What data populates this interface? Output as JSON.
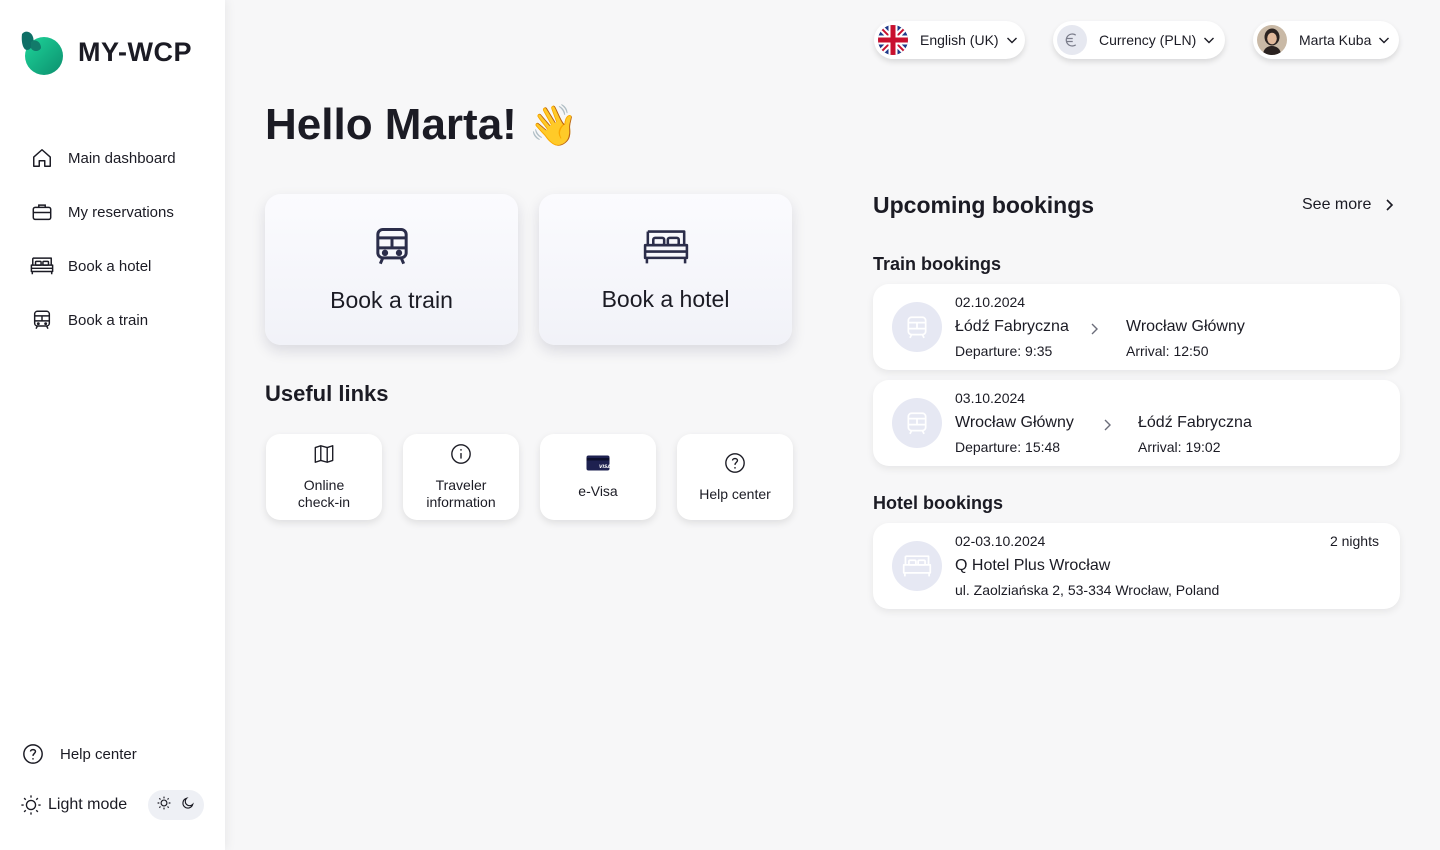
{
  "brand": {
    "name": "MY-WCP"
  },
  "sidebar": {
    "items": [
      {
        "label": "Main dashboard",
        "icon": "home-icon"
      },
      {
        "label": "My reservations",
        "icon": "briefcase-icon"
      },
      {
        "label": "Book a hotel",
        "icon": "bed-icon"
      },
      {
        "label": "Book a train",
        "icon": "train-icon"
      }
    ],
    "help_label": "Help center",
    "mode_label": "Light mode"
  },
  "topbar": {
    "language": "English (UK)",
    "currency": "Currency (PLN)",
    "user": "Marta Kuba"
  },
  "greeting": {
    "text": "Hello Marta!",
    "emoji": "👋"
  },
  "quick_actions": {
    "train": "Book a train",
    "hotel": "Book a hotel"
  },
  "useful_links": {
    "title": "Useful links",
    "items": [
      {
        "line1": "Online",
        "line2": "check-in",
        "icon": "map-icon"
      },
      {
        "line1": "Traveler",
        "line2": "information",
        "icon": "info-icon"
      },
      {
        "line1": "e-Visa",
        "line2": "",
        "icon": "visa-card-icon"
      },
      {
        "line1": "Help center",
        "line2": "",
        "icon": "help-icon"
      }
    ]
  },
  "upcoming": {
    "title": "Upcoming bookings",
    "see_more": "See more",
    "train_title": "Train bookings",
    "trains": [
      {
        "date": "02.10.2024",
        "from": "Łódź Fabryczna",
        "departure": "Departure: 9:35",
        "to": "Wrocław Główny",
        "arrival": "Arrival: 12:50"
      },
      {
        "date": "03.10.2024",
        "from": "Wrocław Główny",
        "departure": "Departure: 15:48",
        "to": "Łódź Fabryczna",
        "arrival": "Arrival: 19:02"
      }
    ],
    "hotel_title": "Hotel bookings",
    "hotels": [
      {
        "dates": "02-03.10.2024",
        "nights": "2 nights",
        "name": "Q Hotel Plus Wrocław",
        "address": "ul. Zaolziańska 2, 53-334 Wrocław, Poland"
      }
    ]
  },
  "colors": {
    "accent_green": "#19c48a",
    "accent_teal": "#0f8c7a",
    "text": "#1b1b24",
    "avatar_bg": "#e6e8f3"
  }
}
